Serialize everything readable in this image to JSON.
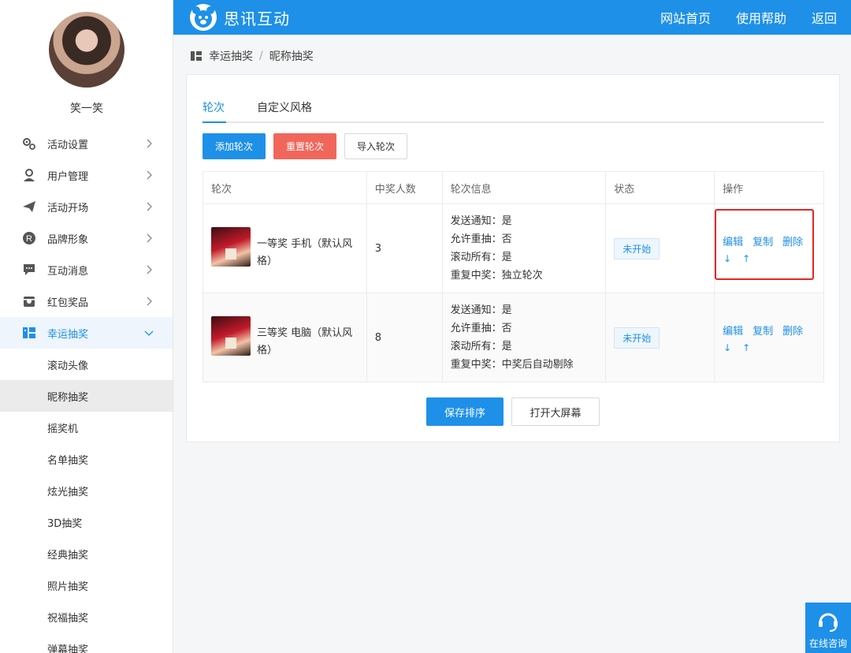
{
  "sidebar": {
    "username": "笑一笑",
    "menu": [
      {
        "label": "活动设置",
        "icon": "gears-icon"
      },
      {
        "label": "用户管理",
        "icon": "user-icon"
      },
      {
        "label": "活动开场",
        "icon": "paper-plane-icon"
      },
      {
        "label": "品牌形象",
        "icon": "registered-icon"
      },
      {
        "label": "互动消息",
        "icon": "chat-icon"
      },
      {
        "label": "红包奖品",
        "icon": "gift-icon"
      },
      {
        "label": "幸运抽奖",
        "icon": "lottery-icon",
        "expanded": true
      }
    ],
    "submenu": [
      "滚动头像",
      "昵称抽奖",
      "摇奖机",
      "名单抽奖",
      "炫光抽奖",
      "3D抽奖",
      "经典抽奖",
      "照片抽奖",
      "祝福抽奖",
      "弹幕抽奖"
    ],
    "current_sub": "昵称抽奖"
  },
  "header": {
    "brand": "思讯互动",
    "nav": [
      "网站首页",
      "使用帮助",
      "返回"
    ]
  },
  "breadcrumb": {
    "parent": "幸运抽奖",
    "separator": "/",
    "current": "昵称抽奖"
  },
  "tabs": [
    "轮次",
    "自定义风格"
  ],
  "actions": {
    "add": "添加轮次",
    "reset": "重置轮次",
    "import": "导入轮次"
  },
  "table": {
    "columns": [
      "轮次",
      "中奖人数",
      "轮次信息",
      "状态",
      "操作"
    ],
    "rows": [
      {
        "round": "一等奖 手机（默认风格）",
        "winners": "3",
        "info": [
          "发送通知：是",
          "允许重抽：否",
          "滚动所有：是",
          "重复中奖：独立轮次"
        ],
        "status": "未开始",
        "ops": [
          "编辑",
          "复制",
          "删除"
        ]
      },
      {
        "round": "三等奖 电脑（默认风格）",
        "winners": "8",
        "info": [
          "发送通知：是",
          "允许重抽：否",
          "滚动所有：是",
          "重复中奖：中奖后自动剔除"
        ],
        "status": "未开始",
        "ops": [
          "编辑",
          "复制",
          "删除"
        ]
      }
    ],
    "sort_arrows": [
      "↓",
      "↑"
    ]
  },
  "footer_buttons": {
    "save": "保存排序",
    "screen": "打开大屏幕"
  },
  "consult": {
    "label": "在线咨询"
  },
  "colors": {
    "primary": "#1e90e8",
    "danger": "#f1665b",
    "highlight": "#e82424"
  }
}
